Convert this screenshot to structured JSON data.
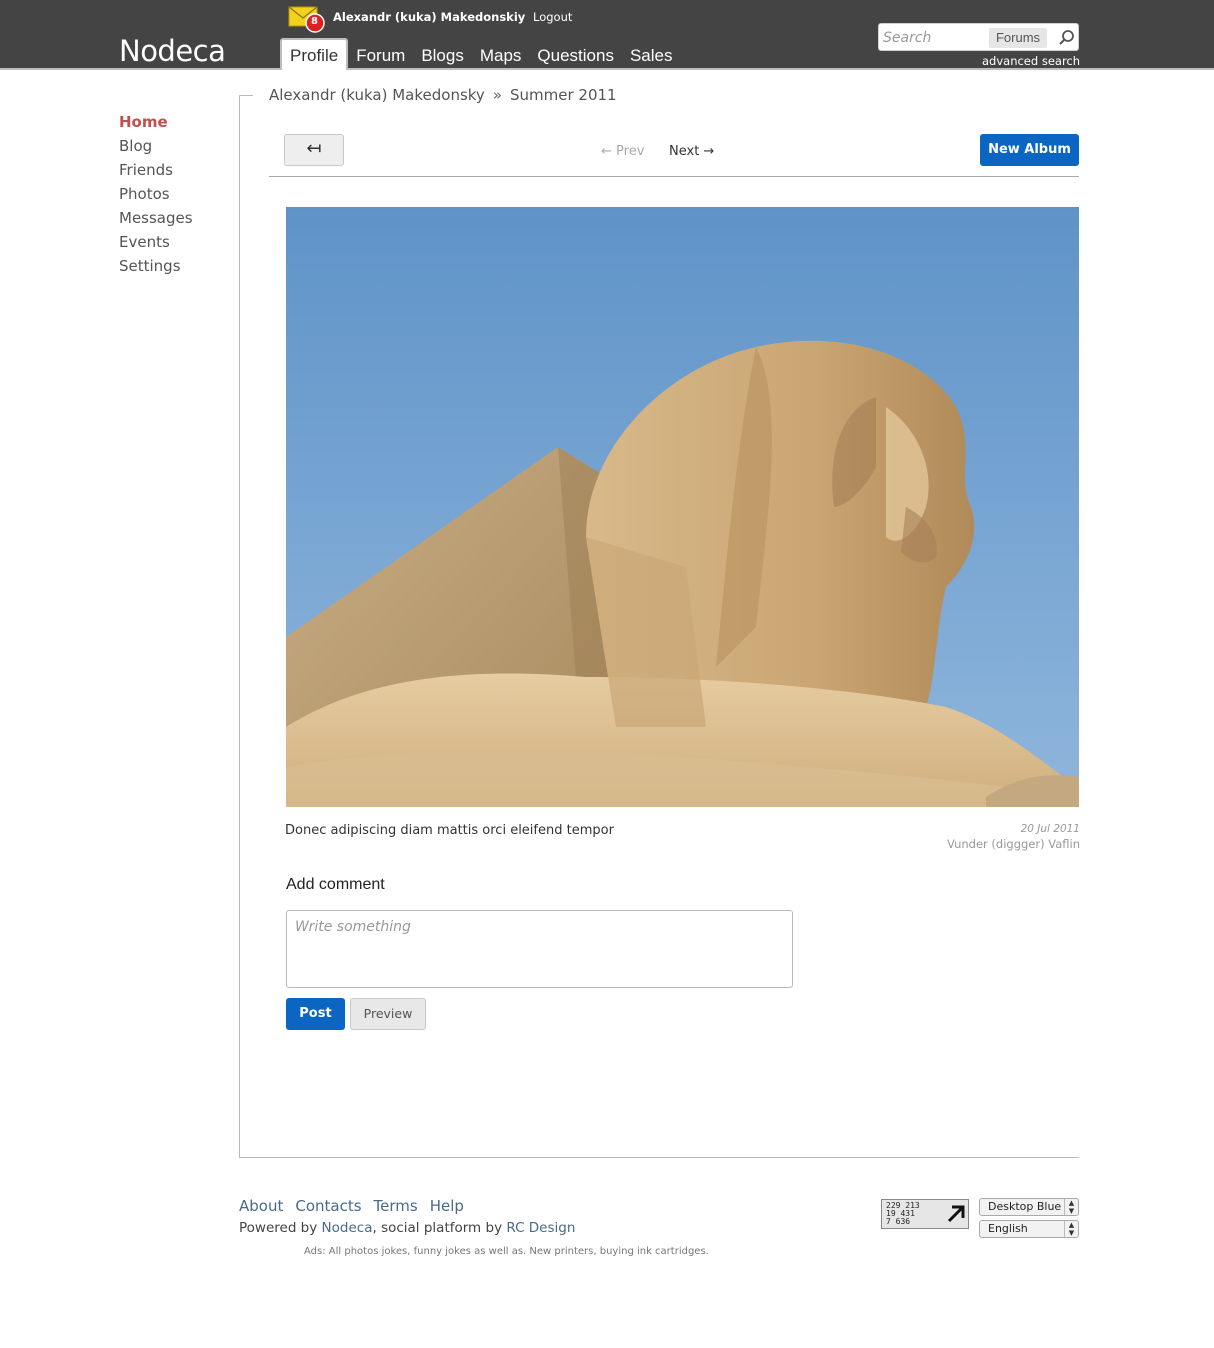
{
  "header": {
    "logo": "Nodeca",
    "mail_count": "8",
    "user_name": "Alexandr (kuka) Makedonskiy",
    "logout": "Logout",
    "tabs": [
      {
        "label": "Profile",
        "active": true
      },
      {
        "label": "Forum"
      },
      {
        "label": "Blogs"
      },
      {
        "label": "Maps"
      },
      {
        "label": "Questions"
      },
      {
        "label": "Sales"
      }
    ],
    "search": {
      "placeholder": "Search",
      "scope": "Forums",
      "advanced": "advanced search"
    }
  },
  "sidebar": {
    "items": [
      {
        "label": "Home",
        "active": true
      },
      {
        "label": "Blog"
      },
      {
        "label": "Friends"
      },
      {
        "label": "Photos"
      },
      {
        "label": "Messages"
      },
      {
        "label": "Events"
      },
      {
        "label": "Settings"
      }
    ]
  },
  "breadcrumb": {
    "user": "Alexandr (kuka) Makedonsky",
    "separator": "»",
    "album": "Summer 2011"
  },
  "album_nav": {
    "back_symbol": "↤",
    "prev": "← Prev",
    "next": "Next →",
    "new_album": "New Album"
  },
  "photo": {
    "caption": "Donec adipiscing diam mattis orci eleifend tempor",
    "date": "20 Jul 2011",
    "author": "Vunder (diggger) Vaflin"
  },
  "comment": {
    "heading": "Add comment",
    "placeholder": "Write something",
    "post": "Post",
    "preview": "Preview"
  },
  "footer": {
    "links": [
      "About",
      "Contacts",
      "Terms",
      "Help"
    ],
    "powered_prefix": "Powered by",
    "powered_brand": "Nodeca",
    "powered_middle": ", social platform by",
    "powered_company": "RC Design",
    "ads": "Ads: All photos jokes, funny jokes as well as. New printers, buying ink cartridges.",
    "counter_lines": [
      "229 213",
      "19 431",
      "7 636"
    ],
    "theme": "Desktop Blue",
    "language": "English"
  },
  "colors": {
    "header_bg": "#444444",
    "accent_blue": "#0a66c2",
    "active_red": "#c0504d",
    "link": "#4a6a8a"
  }
}
